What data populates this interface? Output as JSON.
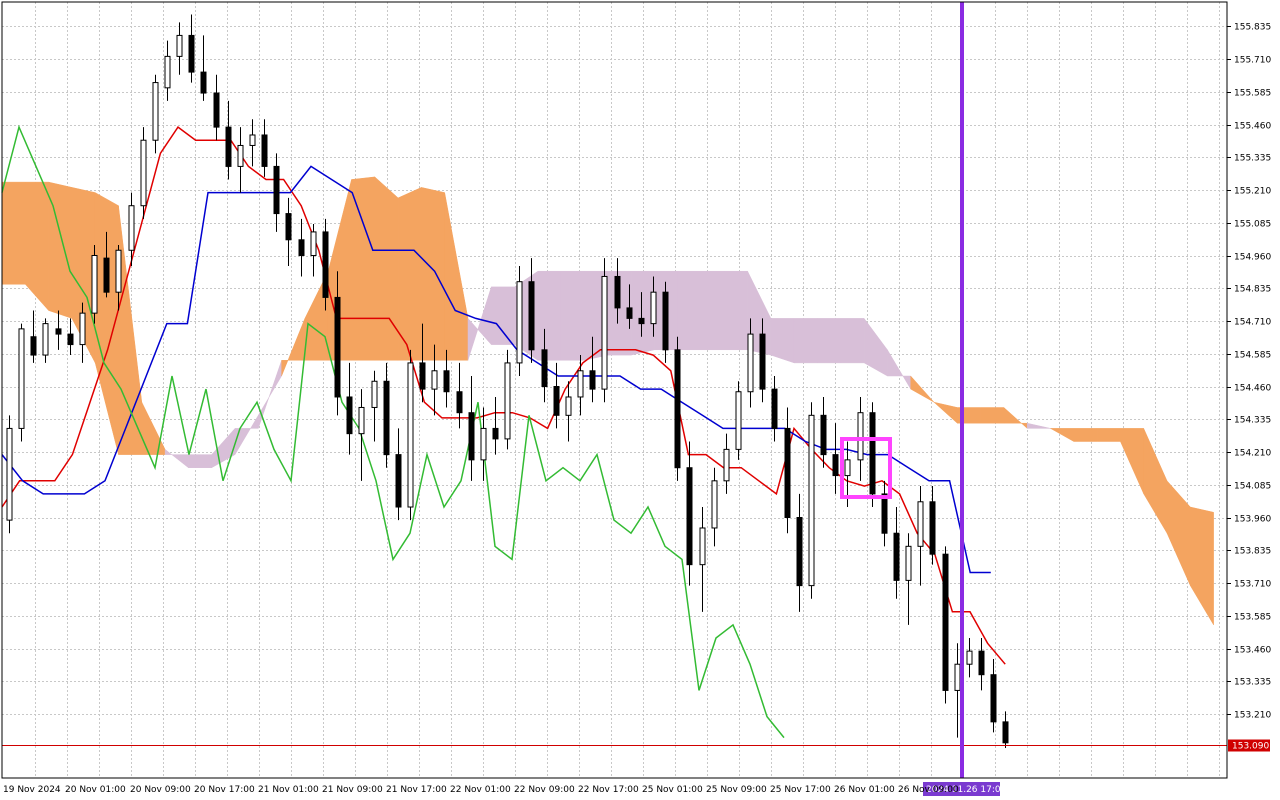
{
  "chart_data": {
    "type": "candlestick",
    "indicator": "Ichimoku Kinko Hyo",
    "grid": true,
    "y_ticks": [
      "155.835",
      "155.710",
      "155.585",
      "155.460",
      "155.335",
      "155.210",
      "155.085",
      "154.960",
      "154.835",
      "154.710",
      "154.585",
      "154.460",
      "154.335",
      "154.210",
      "154.085",
      "153.960",
      "153.835",
      "153.710",
      "153.585",
      "153.460",
      "153.335",
      "153.210"
    ],
    "x_ticks": [
      "19 Nov 2024",
      "20 Nov 01:00",
      "20 Nov 09:00",
      "20 Nov 17:00",
      "21 Nov 01:00",
      "21 Nov 09:00",
      "21 Nov 17:00",
      "22 Nov 01:00",
      "22 Nov 09:00",
      "22 Nov 17:00",
      "25 Nov 01:00",
      "25 Nov 09:00",
      "25 Nov 17:00",
      "26 Nov 01:00",
      "26 Nov 09:00"
    ],
    "ylim": [
      153.1,
      155.9
    ],
    "current_price": 153.09,
    "current_price_label": "153.090",
    "vertical_marker_label": "2024.11.26 17:00",
    "ohlc": [
      [
        153.95,
        154.35,
        153.9,
        154.3
      ],
      [
        154.3,
        154.7,
        154.25,
        154.68
      ],
      [
        154.65,
        154.75,
        154.55,
        154.58
      ],
      [
        154.58,
        154.72,
        154.55,
        154.7
      ],
      [
        154.68,
        154.75,
        154.6,
        154.66
      ],
      [
        154.66,
        154.72,
        154.58,
        154.62
      ],
      [
        154.62,
        154.78,
        154.55,
        154.74
      ],
      [
        154.74,
        155.0,
        154.7,
        154.96
      ],
      [
        154.95,
        155.05,
        154.8,
        154.82
      ],
      [
        154.82,
        155.0,
        154.75,
        154.98
      ],
      [
        154.98,
        155.2,
        154.92,
        155.15
      ],
      [
        155.15,
        155.45,
        155.1,
        155.4
      ],
      [
        155.4,
        155.65,
        155.35,
        155.62
      ],
      [
        155.6,
        155.78,
        155.55,
        155.72
      ],
      [
        155.72,
        155.85,
        155.65,
        155.8
      ],
      [
        155.8,
        155.88,
        155.62,
        155.66
      ],
      [
        155.66,
        155.8,
        155.55,
        155.58
      ],
      [
        155.58,
        155.65,
        155.4,
        155.45
      ],
      [
        155.45,
        155.55,
        155.25,
        155.3
      ],
      [
        155.3,
        155.45,
        155.2,
        155.38
      ],
      [
        155.38,
        155.48,
        155.3,
        155.42
      ],
      [
        155.42,
        155.48,
        155.26,
        155.3
      ],
      [
        155.3,
        155.35,
        155.05,
        155.12
      ],
      [
        155.12,
        155.18,
        154.92,
        155.02
      ],
      [
        155.02,
        155.1,
        154.88,
        154.96
      ],
      [
        154.96,
        155.08,
        154.88,
        155.05
      ],
      [
        155.05,
        155.1,
        154.75,
        154.8
      ],
      [
        154.8,
        154.9,
        154.35,
        154.42
      ],
      [
        154.42,
        154.55,
        154.2,
        154.28
      ],
      [
        154.28,
        154.45,
        154.1,
        154.38
      ],
      [
        154.38,
        154.52,
        154.25,
        154.48
      ],
      [
        154.48,
        154.55,
        154.15,
        154.2
      ],
      [
        154.2,
        154.3,
        153.95,
        154.0
      ],
      [
        154.0,
        154.6,
        153.95,
        154.55
      ],
      [
        154.55,
        154.7,
        154.4,
        154.45
      ],
      [
        154.45,
        154.62,
        154.35,
        154.52
      ],
      [
        154.52,
        154.6,
        154.38,
        154.44
      ],
      [
        154.44,
        154.55,
        154.3,
        154.36
      ],
      [
        154.36,
        154.5,
        154.1,
        154.18
      ],
      [
        154.18,
        154.38,
        154.1,
        154.3
      ],
      [
        154.3,
        154.42,
        154.2,
        154.26
      ],
      [
        154.26,
        154.6,
        154.22,
        154.55
      ],
      [
        154.55,
        154.92,
        154.5,
        154.86
      ],
      [
        154.86,
        154.95,
        154.55,
        154.6
      ],
      [
        154.6,
        154.68,
        154.4,
        154.46
      ],
      [
        154.46,
        154.55,
        154.3,
        154.35
      ],
      [
        154.35,
        154.48,
        154.25,
        154.42
      ],
      [
        154.42,
        154.58,
        154.35,
        154.52
      ],
      [
        154.52,
        154.65,
        154.4,
        154.45
      ],
      [
        154.45,
        154.95,
        154.4,
        154.88
      ],
      [
        154.88,
        154.95,
        154.7,
        154.76
      ],
      [
        154.76,
        154.85,
        154.68,
        154.72
      ],
      [
        154.72,
        154.82,
        154.65,
        154.7
      ],
      [
        154.7,
        154.88,
        154.65,
        154.82
      ],
      [
        154.82,
        154.86,
        154.55,
        154.6
      ],
      [
        154.6,
        154.65,
        154.1,
        154.15
      ],
      [
        154.15,
        154.25,
        153.7,
        153.78
      ],
      [
        153.78,
        154.0,
        153.6,
        153.92
      ],
      [
        153.92,
        154.15,
        153.85,
        154.1
      ],
      [
        154.1,
        154.28,
        154.05,
        154.22
      ],
      [
        154.22,
        154.48,
        154.18,
        154.44
      ],
      [
        154.44,
        154.72,
        154.38,
        154.66
      ],
      [
        154.66,
        154.72,
        154.4,
        154.45
      ],
      [
        154.45,
        154.5,
        154.25,
        154.3
      ],
      [
        154.3,
        154.38,
        153.9,
        153.96
      ],
      [
        153.96,
        154.05,
        153.6,
        153.7
      ],
      [
        153.7,
        154.4,
        153.65,
        154.35
      ],
      [
        154.35,
        154.42,
        154.15,
        154.2
      ],
      [
        154.2,
        154.32,
        154.05,
        154.12
      ],
      [
        154.12,
        154.25,
        154.0,
        154.18
      ],
      [
        154.18,
        154.42,
        154.1,
        154.36
      ],
      [
        154.36,
        154.4,
        154.0,
        154.05
      ],
      [
        154.05,
        154.1,
        153.85,
        153.9
      ],
      [
        153.9,
        154.0,
        153.65,
        153.72
      ],
      [
        153.72,
        153.9,
        153.55,
        153.85
      ],
      [
        153.85,
        154.08,
        153.7,
        154.02
      ],
      [
        154.02,
        154.08,
        153.78,
        153.82
      ],
      [
        153.82,
        153.85,
        153.25,
        153.3
      ],
      [
        153.3,
        153.48,
        153.12,
        153.4
      ],
      [
        153.4,
        153.5,
        153.35,
        153.45
      ],
      [
        153.45,
        153.5,
        153.3,
        153.36
      ],
      [
        153.36,
        153.42,
        153.14,
        153.18
      ],
      [
        153.18,
        153.22,
        153.08,
        153.1
      ]
    ],
    "cloud": {
      "span_a": [
        155.24,
        155.24,
        155.24,
        155.22,
        155.2,
        155.15,
        154.4,
        154.22,
        154.15,
        154.15,
        154.2,
        154.35,
        154.5,
        154.72,
        154.9,
        155.25,
        155.26,
        155.18,
        155.22,
        155.2,
        154.72,
        154.62,
        154.62,
        154.56,
        154.56,
        154.56,
        154.58,
        154.58,
        154.6,
        154.6,
        154.6,
        154.6,
        154.6,
        154.58,
        154.55,
        154.55,
        154.55,
        154.55,
        154.5,
        154.5,
        154.4,
        154.38,
        154.38,
        154.38,
        154.3,
        154.3,
        154.3,
        154.3,
        154.3,
        154.3,
        154.1,
        154.0,
        153.98
      ],
      "span_b": [
        154.85,
        154.85,
        154.75,
        154.72,
        154.55,
        154.2,
        154.2,
        154.2,
        154.2,
        154.2,
        154.3,
        154.3,
        154.56,
        154.56,
        154.56,
        154.56,
        154.56,
        154.56,
        154.56,
        154.56,
        154.56,
        154.84,
        154.84,
        154.9,
        154.9,
        154.9,
        154.9,
        154.9,
        154.9,
        154.9,
        154.9,
        154.9,
        154.9,
        154.72,
        154.72,
        154.72,
        154.72,
        154.72,
        154.6,
        154.45,
        154.4,
        154.32,
        154.32,
        154.32,
        154.32,
        154.3,
        154.25,
        154.25,
        154.25,
        154.05,
        153.9,
        153.7,
        153.55
      ]
    },
    "series": [
      {
        "values": [
          154.0,
          154.1,
          154.1,
          154.1,
          154.2,
          154.4,
          154.6,
          154.85,
          155.1,
          155.35,
          155.45,
          155.4,
          155.4,
          155.4,
          155.3,
          155.25,
          155.25,
          155.15,
          154.98,
          154.72,
          154.72,
          154.72,
          154.72,
          154.62,
          154.4,
          154.34,
          154.34,
          154.34,
          154.36,
          154.36,
          154.34,
          154.3,
          154.45,
          154.55,
          154.6,
          154.6,
          154.6,
          154.58,
          154.52,
          154.2,
          154.2,
          154.15,
          154.15,
          154.1,
          154.05,
          154.3,
          154.22,
          154.15,
          154.1,
          154.08,
          154.1,
          154.05,
          153.9,
          153.82,
          153.6,
          153.6,
          153.48,
          153.4
        ]
      },
      {
        "values": [
          154.2,
          154.1,
          154.05,
          154.05,
          154.05,
          154.1,
          154.3,
          154.5,
          154.7,
          154.7,
          155.2,
          155.2,
          155.2,
          155.2,
          155.2,
          155.3,
          155.25,
          155.2,
          154.98,
          154.98,
          154.98,
          154.9,
          154.75,
          154.72,
          154.7,
          154.6,
          154.55,
          154.5,
          154.5,
          154.5,
          154.5,
          154.45,
          154.45,
          154.4,
          154.35,
          154.3,
          154.3,
          154.3,
          154.3,
          154.25,
          154.22,
          154.22,
          154.2,
          154.2,
          154.15,
          154.1,
          154.1,
          153.75,
          153.75
        ]
      },
      {
        "values": [
          155.2,
          155.45,
          155.3,
          155.15,
          154.9,
          154.8,
          154.55,
          154.45,
          154.3,
          154.15,
          154.5,
          154.2,
          154.45,
          154.1,
          154.3,
          154.4,
          154.22,
          154.1,
          154.7,
          154.65,
          154.4,
          154.3,
          154.1,
          153.8,
          153.9,
          154.2,
          154.0,
          154.1,
          154.4,
          153.85,
          153.8,
          154.35,
          154.1,
          154.15,
          154.1,
          154.2,
          153.95,
          153.9,
          154.0,
          153.85,
          153.8,
          153.3,
          153.5,
          153.55,
          153.4,
          153.2,
          153.12
        ]
      }
    ]
  }
}
